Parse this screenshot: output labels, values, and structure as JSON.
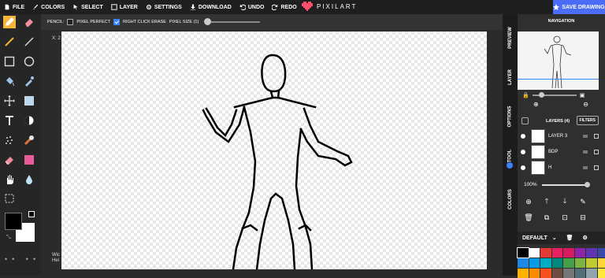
{
  "menu": [
    {
      "label": "FILE",
      "icon": "file-icon"
    },
    {
      "label": "COLORS",
      "icon": "palette-icon"
    },
    {
      "label": "SELECT",
      "icon": "cursor-icon"
    },
    {
      "label": "LAYER",
      "icon": "layer-icon"
    },
    {
      "label": "SETTINGS",
      "icon": "gear-icon"
    },
    {
      "label": "DOWNLOAD",
      "icon": "download-icon"
    },
    {
      "label": "UNDO",
      "icon": "undo-icon"
    },
    {
      "label": "REDO",
      "icon": "redo-icon"
    }
  ],
  "brand": {
    "name": "PIXILART",
    "color": "#ff4d6d"
  },
  "save": {
    "label": "SAVE DRAWING",
    "color": "#4a6cf7"
  },
  "options": {
    "tool_label": "PENCIL:",
    "pixel_perfect": "PIXEL PERFECT",
    "pixel_perfect_checked": false,
    "right_click_erase": "RIGHT CLICK ERASE",
    "right_click_erase_checked": true,
    "pixel_size": "PIXEL SIZE (1)"
  },
  "workspace": {
    "coord": "X: 2",
    "dims_line1": "Wic",
    "dims_line2": "Hei"
  },
  "side_tabs": [
    "PREVIEW",
    "LAYER",
    "OPTIONS",
    "TOOL",
    "COLORS"
  ],
  "navigation": {
    "title": "NAVIGATION"
  },
  "layers": {
    "title": "LAYERS (4)",
    "filters": "FILTERS",
    "items": [
      {
        "name": "LAYER 3"
      },
      {
        "name": "BDP"
      },
      {
        "name": "H"
      }
    ],
    "opacity": "100%"
  },
  "palette": {
    "name": "DEFAULT",
    "colors": [
      "#000000",
      "#ffffff",
      "#e53935",
      "#e91e63",
      "#d81b60",
      "#8e24aa",
      "#5e35b1",
      "#3949ab",
      "#1e88e5",
      "#039be5",
      "#00acc1",
      "#00897b",
      "#43a047",
      "#7cb342",
      "#c0ca33",
      "#fdd835",
      "#ffb300",
      "#fb8c00",
      "#f4511e",
      "#6d4c41",
      "#757575",
      "#546e7a",
      "#90a4ae",
      "#ffeb3b"
    ]
  },
  "primary_color": "#000000",
  "secondary_color": "#ffffff"
}
